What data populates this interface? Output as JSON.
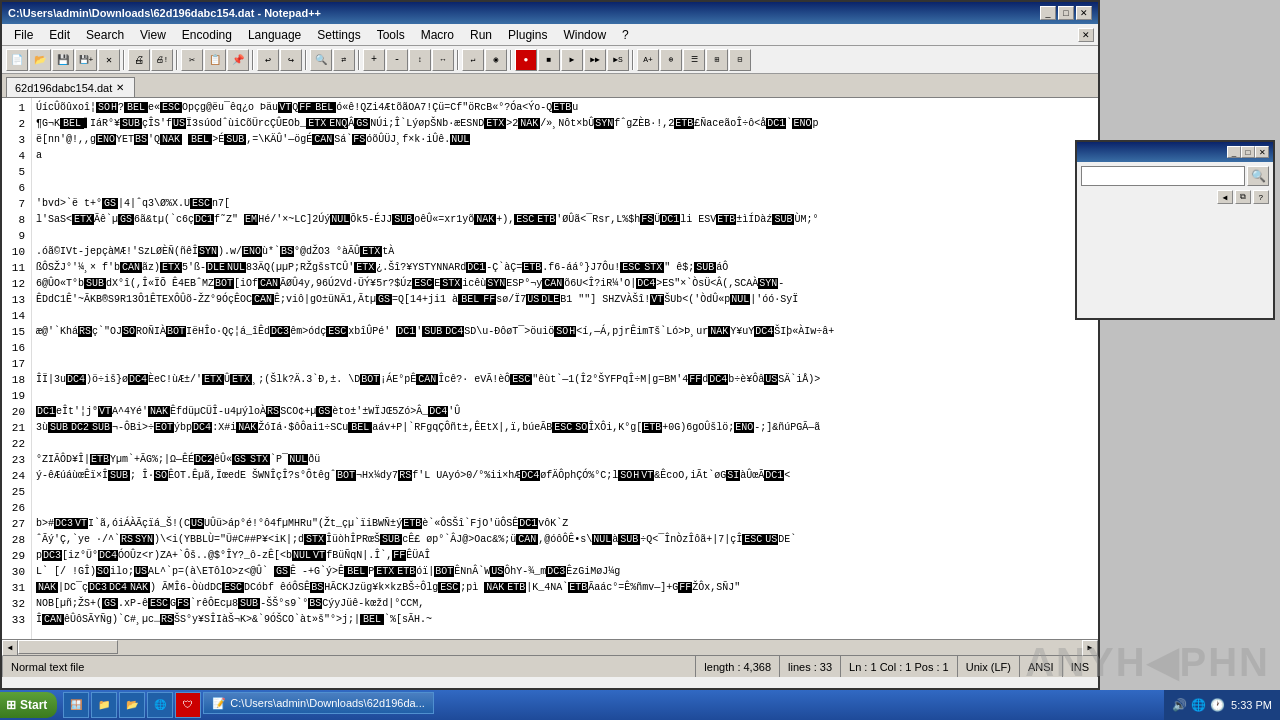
{
  "window": {
    "title": "C:\\Users\\admin\\Downloads\\62d196dabc154.dat - Notepad++",
    "title_short": "C:\\Users\\admin\\Downloads\\62d196dabc154.dat - Notepad++"
  },
  "menu": {
    "items": [
      "File",
      "Edit",
      "Search",
      "View",
      "Encoding",
      "Language",
      "Settings",
      "Tools",
      "Macro",
      "Run",
      "Plugins",
      "Window",
      "?"
    ]
  },
  "tab": {
    "label": "62d196dabc154.dat"
  },
  "status": {
    "file_type": "Normal text file",
    "length": "length : 4,368",
    "lines": "lines : 33",
    "cursor": "Ln : 1   Col : 1   Pos : 1",
    "line_ending": "Unix (LF)",
    "encoding": "ANSI",
    "mode": "INS"
  },
  "code_lines": [
    "  ÚícÛõûxoî¦SOH?BELe«ESCOpçg@ëu¯êq¿o  ÞäuVTQFFBELó«ê!QZi4ÆtõãOA7!Çü=Cf\"öRcB«°?Óa<Ýo-QETBu",
    " ¶G¬KBEL▌IáR°¥SUBçÎS'fUSÏ3súOdˆùiCõÜrcÇÛEOb_ETXENQÂGSNÚi;Î`LýøpŠNb·æESNDETX>2NAK/»¸Nôt×bÛSYNfˆgZÈB·!,2ETB£ÑaceãoÎ÷ô<åDC1`ENOp",
    " ë[nn'@!,,gENOYETBS'QNAK BEL>ÉSUB,=\\KÄÛ'—ögÉCANSá`FSóõÛÜJ¸f×k·iÛê.NUL",
    " a",
    "",
    "",
    "  'bvd>`ë      t+°GS|4|ˆq3\\Ø%X.UESCn7[",
    " l'SaS<ETXÃê`µGS6ã&tµ(`c6çDC1f˜Z\" EMHé/'×~LC]2ÚýNULÕk5-ÉJJSUBoêÛ«=xr1yõNAK+),ESCETB'ØÛã<¯Rsr,L%$hFSÜDC1li  ESVETB±ìÍDàźSUBÙM;°",
    "",
    " .óã©IVt-jepçàMÆ!'SzLØÈÑ(ñêÎSYN).w/ENOù*`BS°@dŽO3  °àÃÛETXtÀ",
    " ßÔSŽJ°'¼¸×  f'bCANãz)ETX5'ß-DLENUL83ÄQ(µµP;RŽgšsTCÛ'ETX¿.Šî?¥YSTYNNARdDC1-Ç`àÇ=ETB.f6-áá°}J7Ôu!ESCSTX\"  ê$;SUBáÔ",
    " 6@ÛO«T°bSUBdX°î(,Î«ÏÕ   Ê4EBˆMZBOT[iOfCANÃØÛ4y,96Ú2Vd·ÜÝ¥5r?$ÚzESCESTXicêùSYNESP°¬yCANõ6U<Î?iR¼'O|DC4>ES\"×`ÒsÜ<Â(,SCAÀSYN-",
    " ÊDdC1Ê'~ÃKB®S9R13Ô1ÊTEXÔÛõ-ŽZ°9ÓçÊOCCANÊ;viô|gO±üNÄ1,ÃtµGS=Q[14+ji1  àBELFFsø/Ï7USDLEB1   \"\"] SHZVÀŠî!VTŠUb<('ÒdÛ«pNUL|'óó·SyÏ",
    "",
    " æ@'`KháRSç`\"OJSOROÑIÀBOTIëHÎo·Qç¦á_îÊdDC3êm>ódçESCxbîÛPé'  DC1'SUBDC4SD\\u-ÐôøT¯>öuiöSOH<í,—Á,pjrÊimTš`Ló>Þ¸urNAKY¥uYDC4ŠIþ«ÀIw÷â+",
    "",
    "",
    " ÎÏ|3uDC4)ö÷iš}øDC4ÈeC!ùÆ±/'ETXÛETX¸;(Šlk?Ä.3`Ð,±.       \\DBOT¡ÁE°pÊCANÎcê?·  eVÃ!èÔESC\"êùt`—1(Î2°ŠYFPqÎ÷M|g=BM'4FFdDC4b÷è¥ÔâUSSÄ`iÅ)>",
    "",
    " DC1eÎt'¦j⁰VTA^4Yé'NAKÊfdüµCÜÎ-u4µýloÀRSSCO¢+µGSèto±'±WÏJŒ5Zó>Â_DC4'Û",
    " 3ùSUBDC2SUB¬-ÔBi>÷EOTýbpDC4:X#iNAKŽóIá·$ôÔai1÷SCuBELaáv+P|`RFgqÇÔñt±,ÊEtX|,ï,búeÃBESCSOÎXÔi,K°g[ETB+0G)6gOÛšlö;ENO-;]&ñúPGÃ—ã",
    "",
    " °ZIÃÔD¥Î|ETBYµm`+ÃG%;|Ω—ÊÉDC2êÛ«GSSTX`P¯NULðü",
    " ý-êÆúáùœÊï×ÎSUB;  Î·SOÊOT.Êµã,ÏœedE  ŠWNÎçÎ?s°ÔtêgˆBOT¬Hx¼dy7RSf'L      UAyó>0/°%ii×hÆDC4øfÄÔphÇÓ%°C;lSOHVT&ÊcoO,iÃt`øGSIàÛœÃDC1<",
    "",
    "",
    " b>#DC3VTI`ã,óiÁÀÃçïá_Š!(CUSUÛü>áp°é!°ô4fµMHRu\"(Žt_çµ`ïiBWÑ±ýETBè`«ÔSŠî`FjO'üÔSÊDC1vôK`Z",
    " ˆÃý'Ç,`ye  ·/^`RSSYN)\\<i(YBBLÙ=\"Ü#C##P¥<iK|;dSTXÎüòhÎPRœŠSUBcÊ£     øp°`ÂJ@>Oac&%;üCAN,@óôÔÊ•s\\NULàSUB÷Q<¯ÎnÒzÎôã+|7|çÎESCUSDE`",
    " pDC3[iz°Ü°DC4ÓOÛz<r)ZA+`Ôš..@$°ÎY?_ô-zÊ[<bNULVTfBüÑqN|.Î`,FFÊÜAÎ",
    " L` [/  !GÎ)SOilo;USAL^`p=(à\\ETôlO>z<@Û`  GSÊ  -+G`ý>ÊBELPETXETBóï|BOTÊNnÂ`WUSÔhY-¾_mDC3ÊzGiMøJ¼g",
    " NAK|DC¯çDC3DC4NAK)  ÃMÎ6-ÒùdDCESCDCóbf        êóÔSÊBSHÃCKJzüg¥k×kzBŠ÷ÔlgESC;pì  NAKETB|K_4NA`ETBÃaác°=Ê%ñmv—]+GFFŽÔx,SÑJ\"",
    " NOB[µñ;ŽS+(GS.xP-êESCGFS`rêÔEcµ8SUB-ŠŠ°s9`°BSCýyJüê-kœžd|°CCM,",
    " ÎCANêÛôSÃYÑg)`C#¸µc…RSŠS°y¥SÎIàŠ¬K>&`9ÓŠCO`àt»š\"°>j;|BEL`%[sÃH.~"
  ],
  "small_window": {
    "title": ""
  },
  "taskbar": {
    "start_label": "Start",
    "active_window": "C:\\Users\\admin\\Downloads\\62d196da...",
    "time": "5:33 PM"
  },
  "watermark": "ANYH  PHN"
}
